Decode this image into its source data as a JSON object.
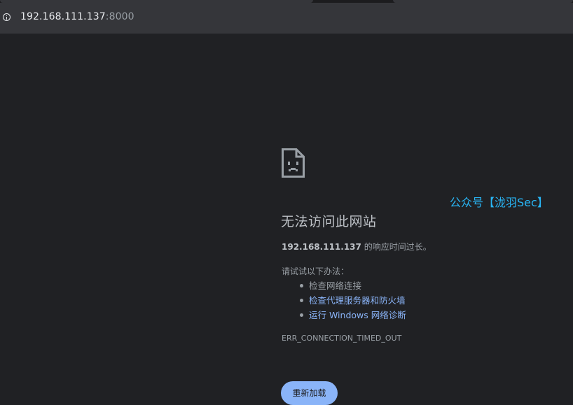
{
  "browser": {
    "url_host": "192.168.111.137",
    "url_port": ":8000",
    "info_icon": "info-circle-icon"
  },
  "watermark": "公众号【泷羽Sec】",
  "error_page": {
    "icon": "sad-page-icon",
    "title": "无法访问此网站",
    "host": "192.168.111.137",
    "description_suffix": " 的响应时间过长。",
    "try_label": "请试试以下办法：",
    "suggestions": [
      {
        "label": "检查网络连接",
        "is_link": false
      },
      {
        "label": "检查代理服务器和防火墙",
        "is_link": true
      },
      {
        "label": "运行 Windows 网络诊断",
        "is_link": true
      }
    ],
    "error_code": "ERR_CONNECTION_TIMED_OUT",
    "reload_label": "重新加载"
  },
  "colors": {
    "background": "#202124",
    "address_bar": "#35363a",
    "text": "#9aa0a6",
    "link": "#8ab4f8",
    "button": "#8ab4f8",
    "watermark": "#29b6f6"
  }
}
